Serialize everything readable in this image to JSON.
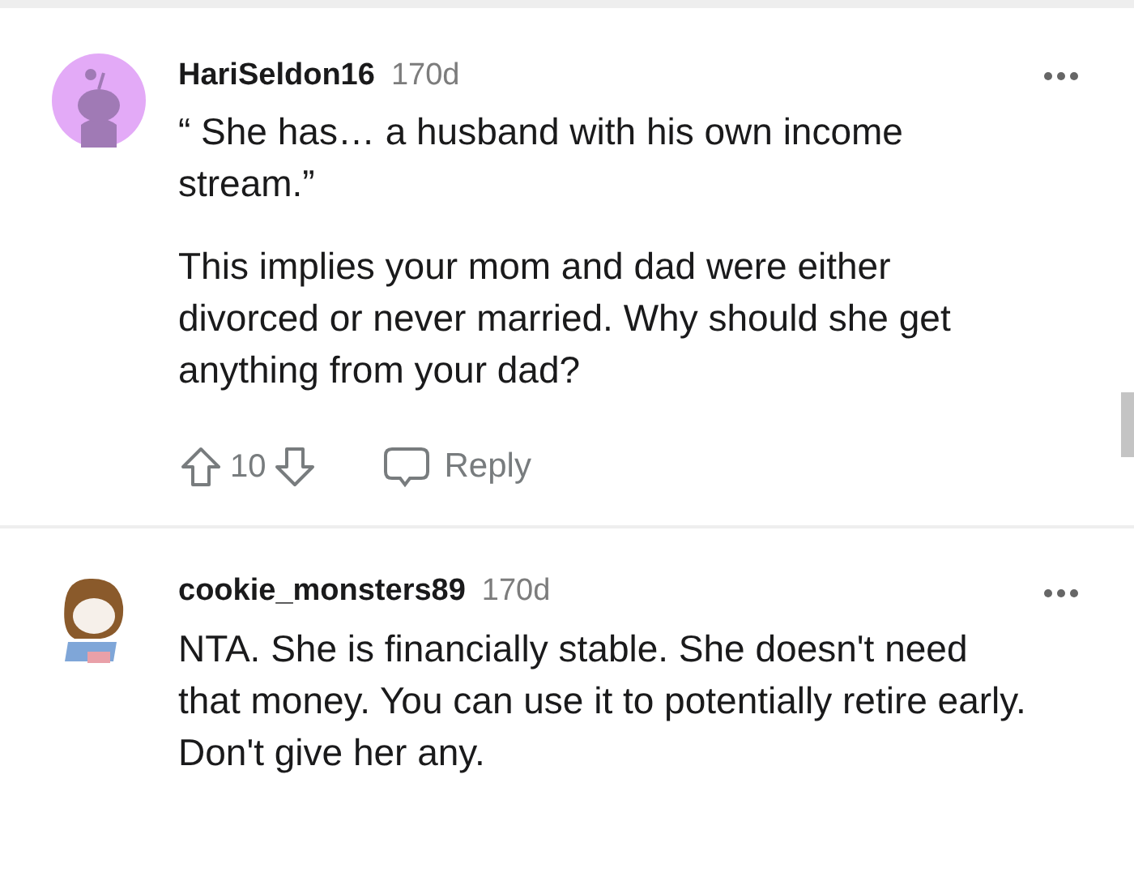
{
  "comments": [
    {
      "author": "HariSeldon16",
      "age": "170d",
      "kind": "snoo",
      "paragraphs": [
        "“ She has… a husband with his own income stream.”",
        "This implies your mom and dad were either divorced or never married. Why should she get anything from your dad?"
      ],
      "votes": "10",
      "reply": "Reply"
    },
    {
      "author": "cookie_monsters89",
      "age": "170d",
      "kind": "character",
      "paragraphs": [
        "NTA. She is financially stable. She doesn't need that money. You can use it to potentially retire early. Don't give her any."
      ]
    }
  ]
}
